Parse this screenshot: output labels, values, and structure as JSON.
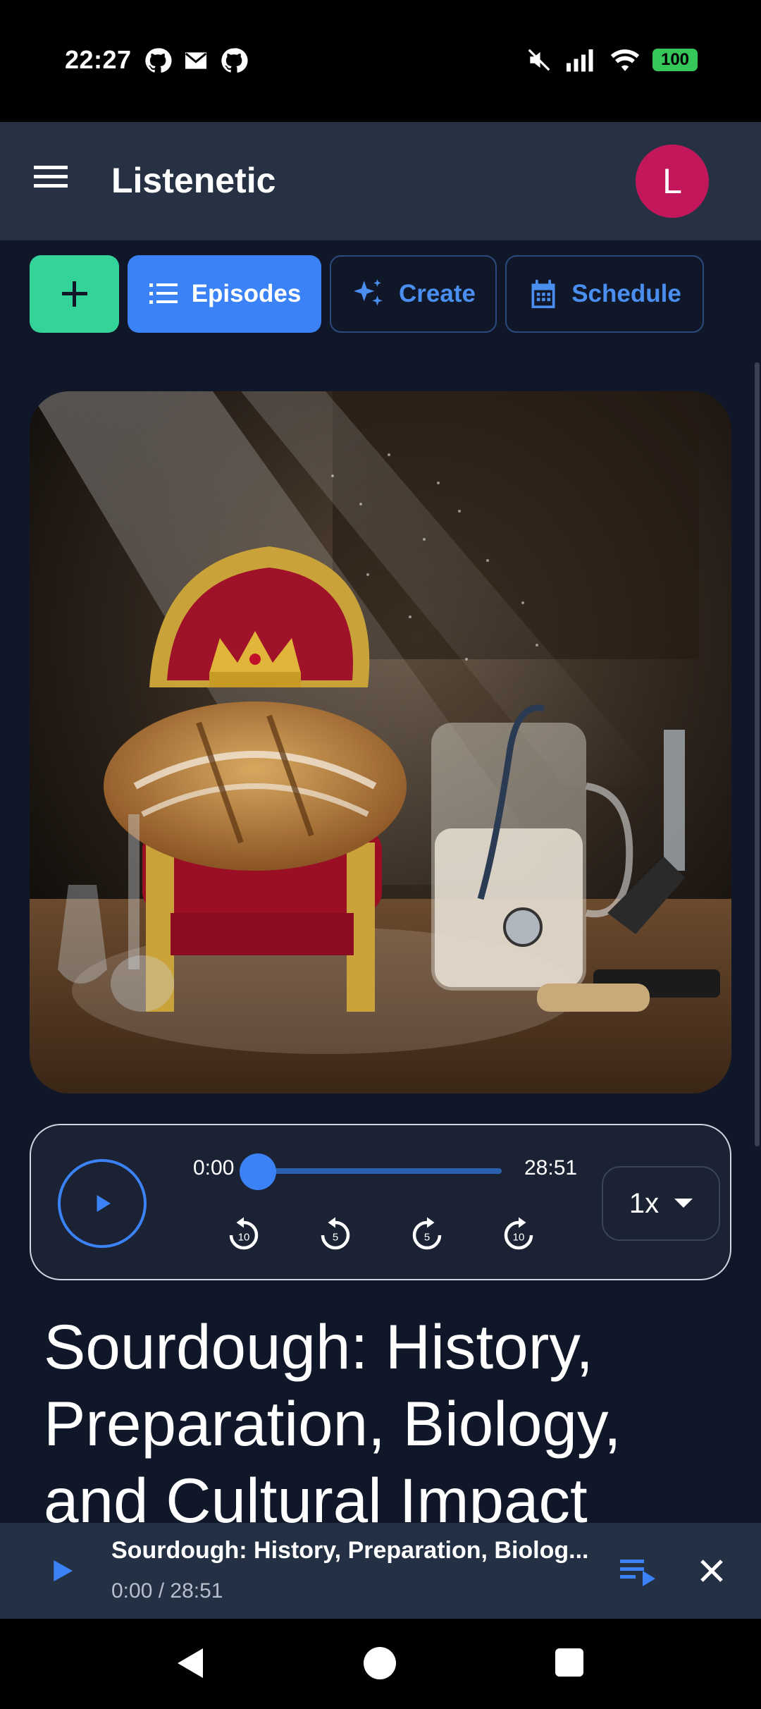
{
  "status_bar": {
    "time": "22:27",
    "left_icons": [
      "github-icon",
      "mail-icon",
      "github-icon"
    ],
    "right_icons": [
      "mute-icon",
      "signal-icon",
      "wifi-icon",
      "battery-icon"
    ],
    "battery": "100"
  },
  "app_bar": {
    "title": "Listenetic",
    "avatar_letter": "L"
  },
  "tabs": {
    "add_icon": "plus-icon",
    "episodes": "Episodes",
    "create": "Create",
    "schedule": "Schedule"
  },
  "player": {
    "time_start": "0:00",
    "time_end": "28:51",
    "progress": 0,
    "skip_back_10": "10",
    "skip_back_5": "5",
    "skip_fwd_5": "5",
    "skip_fwd_10": "10",
    "speed": "1x"
  },
  "episode": {
    "title": "Sourdough: History, Preparation, Biology, and Cultural Impact"
  },
  "mini_player": {
    "title": "Sourdough: History, Preparation, Biolog...",
    "time": "0:00 / 28:51"
  },
  "colors": {
    "accent": "#3b82f6",
    "add_button": "#34d399",
    "avatar": "#c2185b",
    "background": "#0f1729"
  }
}
